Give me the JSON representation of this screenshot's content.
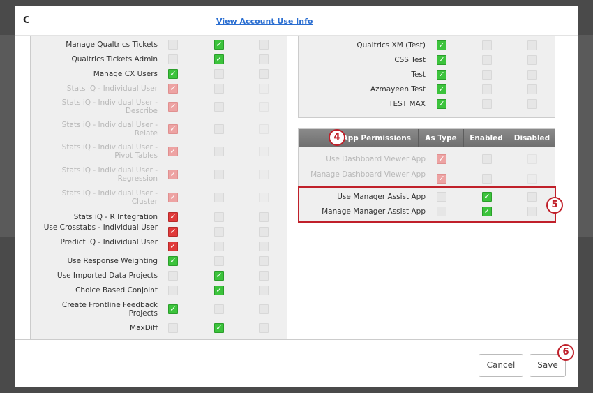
{
  "header": {
    "title": "C",
    "account_link": "View Account Use Info"
  },
  "left_rows": [
    {
      "label": "Manage Qualtrics Tickets",
      "dim": false,
      "checks": [
        "empty",
        "green",
        "empty"
      ]
    },
    {
      "label": "Qualtrics Tickets Admin",
      "dim": false,
      "checks": [
        "empty",
        "green",
        "empty"
      ]
    },
    {
      "label": "Manage CX Users",
      "dim": false,
      "checks": [
        "green",
        "empty",
        "empty"
      ]
    },
    {
      "label": "Stats iQ - Individual User",
      "dim": true,
      "checks": [
        "pink",
        "empty",
        "faint"
      ]
    },
    {
      "label": "Stats iQ - Individual User - Describe",
      "dim": true,
      "checks": [
        "pink",
        "empty",
        "faint"
      ]
    },
    {
      "label": "Stats iQ - Individual User - Relate",
      "dim": true,
      "checks": [
        "pink",
        "empty",
        "faint"
      ]
    },
    {
      "label": "Stats iQ - Individual User - Pivot Tables",
      "dim": true,
      "checks": [
        "pink",
        "empty",
        "faint"
      ]
    },
    {
      "label": "Stats iQ - Individual User - Regression",
      "dim": true,
      "checks": [
        "pink",
        "empty",
        "faint"
      ]
    },
    {
      "label": "Stats iQ - Individual User - Cluster",
      "dim": true,
      "checks": [
        "pink",
        "empty",
        "faint"
      ]
    },
    {
      "label": "Stats iQ - R Integration",
      "dim": false,
      "checks": [
        "red",
        "empty",
        "empty"
      ]
    },
    {
      "label": "Use Crosstabs - Individual User",
      "dim": false,
      "checks": [
        "red",
        "empty",
        "empty"
      ]
    },
    {
      "label": "Predict iQ - Individual User",
      "dim": false,
      "checks": [
        "red",
        "empty",
        "empty"
      ]
    },
    {
      "label": "Use Response Weighting",
      "dim": false,
      "checks": [
        "green",
        "empty",
        "empty"
      ]
    },
    {
      "label": "Use Imported Data Projects",
      "dim": false,
      "checks": [
        "empty",
        "green",
        "empty"
      ]
    },
    {
      "label": "Choice Based Conjoint",
      "dim": false,
      "checks": [
        "empty",
        "green",
        "empty"
      ]
    },
    {
      "label": "Create Frontline Feedback Projects",
      "dim": false,
      "checks": [
        "green",
        "empty",
        "empty"
      ]
    },
    {
      "label": "MaxDiff",
      "dim": false,
      "checks": [
        "empty",
        "green",
        "empty"
      ]
    }
  ],
  "right_rows": [
    {
      "label": "Qualtrics XM (Test)",
      "dim": false,
      "checks": [
        "green",
        "empty",
        "empty"
      ]
    },
    {
      "label": "CSS Test",
      "dim": false,
      "checks": [
        "green",
        "empty",
        "empty"
      ]
    },
    {
      "label": "Test",
      "dim": false,
      "checks": [
        "green",
        "empty",
        "empty"
      ]
    },
    {
      "label": "Azmayeen Test",
      "dim": false,
      "checks": [
        "green",
        "empty",
        "empty"
      ]
    },
    {
      "label": "TEST MAX",
      "dim": false,
      "checks": [
        "green",
        "empty",
        "empty"
      ]
    }
  ],
  "app_permissions": {
    "headers": [
      "App Permissions",
      "As Type",
      "Enabled",
      "Disabled"
    ],
    "rows": [
      {
        "label": "Use Dashboard Viewer App",
        "dim": true,
        "checks": [
          "pink",
          "empty",
          "faint"
        ]
      },
      {
        "label": "Manage Dashboard Viewer App",
        "dim": true,
        "checks": [
          "pink",
          "empty",
          "faint"
        ]
      },
      {
        "label": "Use Manager Assist App",
        "dim": false,
        "checks": [
          "empty",
          "green",
          "empty"
        ]
      },
      {
        "label": "Manage Manager Assist App",
        "dim": false,
        "checks": [
          "empty",
          "green",
          "empty"
        ]
      }
    ]
  },
  "badges": {
    "step4": "4",
    "step5": "5",
    "step6": "6"
  },
  "footer": {
    "cancel": "Cancel",
    "save": "Save"
  },
  "colors": {
    "accent": "#c0202a",
    "check_green": "#3cc33c",
    "check_red": "#e03a3a"
  }
}
